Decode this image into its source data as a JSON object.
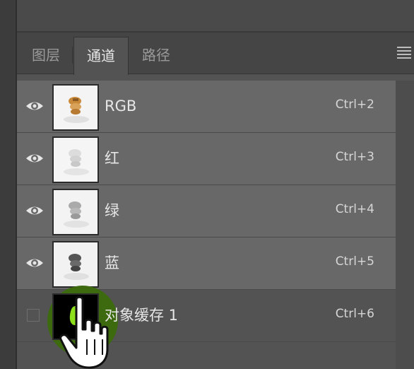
{
  "panel": {
    "tabs": [
      {
        "label": "图层",
        "active": false
      },
      {
        "label": "通道",
        "active": true
      },
      {
        "label": "路径",
        "active": false
      }
    ],
    "menu_icon": "panel-menu-icon"
  },
  "channels": [
    {
      "name": "RGB",
      "shortcut": "Ctrl+2",
      "visible": true,
      "selected": true,
      "thumb": "rgb-color"
    },
    {
      "name": "红",
      "shortcut": "Ctrl+3",
      "visible": true,
      "selected": true,
      "thumb": "red-gray"
    },
    {
      "name": "绿",
      "shortcut": "Ctrl+4",
      "visible": true,
      "selected": true,
      "thumb": "green-gray"
    },
    {
      "name": "蓝",
      "shortcut": "Ctrl+5",
      "visible": true,
      "selected": true,
      "thumb": "blue-gray"
    },
    {
      "name": "对象缓存 1",
      "shortcut": "Ctrl+6",
      "visible": false,
      "selected": false,
      "thumb": "alpha-mask"
    }
  ],
  "colors": {
    "highlight_ring": "#3d6a0f",
    "mask_green": "#8fe01c",
    "selected_row": "#686868"
  },
  "cursor": "hand-pointer-icon"
}
